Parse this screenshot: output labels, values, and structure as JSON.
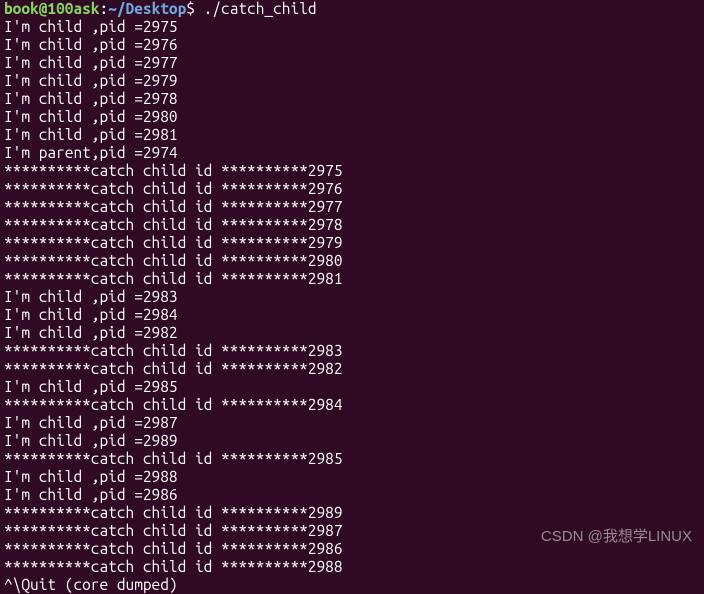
{
  "prompt": {
    "user_host": "book@100ask",
    "colon": ":",
    "path": "~/Desktop",
    "dollar": "$",
    "command": "./catch_child"
  },
  "lines": [
    "I'm child ,pid =2975",
    "I'm child ,pid =2976",
    "I'm child ,pid =2977",
    "I'm child ,pid =2979",
    "I'm child ,pid =2978",
    "I'm child ,pid =2980",
    "I'm child ,pid =2981",
    "I'm parent,pid =2974",
    "**********catch child id **********2975",
    "**********catch child id **********2976",
    "**********catch child id **********2977",
    "**********catch child id **********2978",
    "**********catch child id **********2979",
    "**********catch child id **********2980",
    "**********catch child id **********2981",
    "I'm child ,pid =2983",
    "I'm child ,pid =2984",
    "I'm child ,pid =2982",
    "**********catch child id **********2983",
    "**********catch child id **********2982",
    "I'm child ,pid =2985",
    "**********catch child id **********2984",
    "I'm child ,pid =2987",
    "I'm child ,pid =2989",
    "**********catch child id **********2985",
    "I'm child ,pid =2988",
    "I'm child ,pid =2986",
    "**********catch child id **********2989",
    "**********catch child id **********2987",
    "**********catch child id **********2986",
    "**********catch child id **********2988",
    "^\\Quit (core dumped)"
  ],
  "watermark": "CSDN @我想学LINUX"
}
